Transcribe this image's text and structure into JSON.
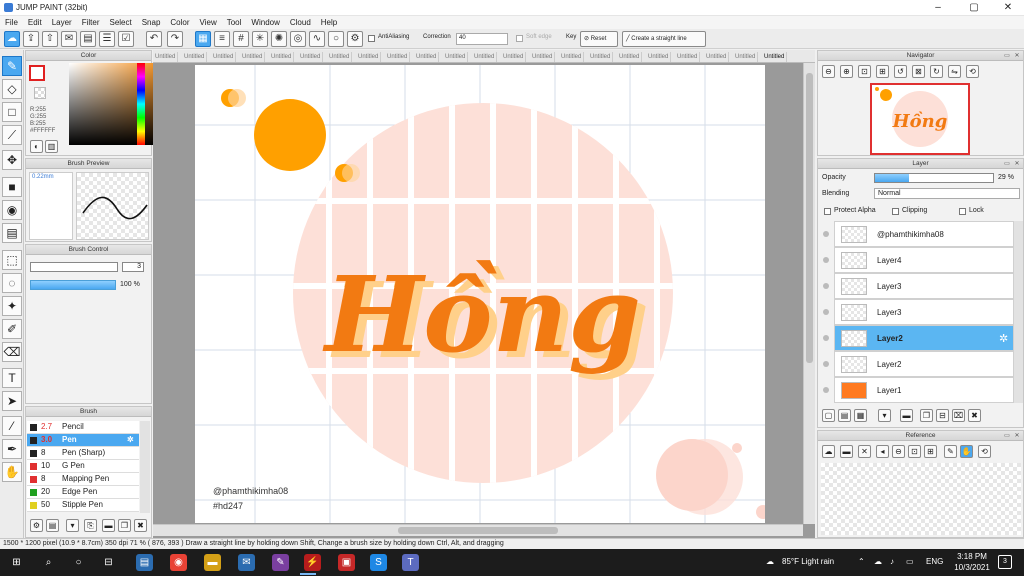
{
  "window": {
    "title": "JUMP PAINT (32bit)"
  },
  "menu": [
    "File",
    "Edit",
    "Layer",
    "Filter",
    "Select",
    "Snap",
    "Color",
    "View",
    "Tool",
    "Window",
    "Cloud",
    "Help"
  ],
  "toolbar": {
    "antialiasing_label": "AntiAliasing",
    "correction_label": "Correction",
    "correction_value": "40",
    "soft_edge_label": "Soft edge",
    "key_label": "Key",
    "reset_label": "Reset",
    "straight_line_label": "Create a straight line"
  },
  "color_panel": {
    "title": "Color",
    "r": "R:255",
    "g": "G:255",
    "b": "B:255",
    "hex": "#FFFFFF"
  },
  "brush_preview": {
    "title": "Brush Preview",
    "size_label": "0.22mm"
  },
  "brush_control": {
    "title": "Brush Control",
    "size_value": "3",
    "opacity_value": "100 %"
  },
  "brush_list": {
    "title": "Brush",
    "items": [
      {
        "size": "2.7",
        "name": "Pencil",
        "color": "#222222"
      },
      {
        "size": "3.0",
        "name": "Pen",
        "color": "#222222"
      },
      {
        "size": "8",
        "name": "Pen (Sharp)",
        "color": "#222222"
      },
      {
        "size": "10",
        "name": "G Pen",
        "color": "#e03030"
      },
      {
        "size": "8",
        "name": "Mapping Pen",
        "color": "#e03030"
      },
      {
        "size": "20",
        "name": "Edge Pen",
        "color": "#20a020"
      },
      {
        "size": "50",
        "name": "Stipple Pen",
        "color": "#e0d020"
      }
    ]
  },
  "doc_tab_label": "Untitled",
  "artwork": {
    "lettering": "Hồng",
    "credit_handle": "@phamthikimha08",
    "credit_tag": "#hd247",
    "colors": {
      "circle_pink": "#fde0d8",
      "accent_orange": "#f7a21b",
      "dot_orange": "#ffa500"
    }
  },
  "navigator": {
    "title": "Navigator"
  },
  "layer_panel": {
    "title": "Layer",
    "opacity_label": "Opacity",
    "opacity_value": "29 %",
    "opacity_fraction": 0.29,
    "blending_label": "Blending",
    "blending_value": "Normal",
    "protect_alpha_label": "Protect Alpha",
    "clipping_label": "Clipping",
    "lock_label": "Lock",
    "layers": [
      "@phamthikimha08",
      "Layer4",
      "Layer3",
      "Layer3",
      "Layer2",
      "Layer2",
      "Layer1"
    ],
    "selected_index": 4
  },
  "reference": {
    "title": "Reference"
  },
  "statusbar": {
    "text": "1500 * 1200 pixel   (10.9 * 8.7cm)   350 dpi   71 %   ( 876, 393 )   Draw a straight line by holding down Shift, Change a brush size by holding down Ctrl, Alt, and dragging"
  },
  "taskbar": {
    "weather": "85°F  Light rain",
    "language": "ENG",
    "time": "3:18 PM",
    "date": "10/3/2021",
    "notifications": "3"
  }
}
